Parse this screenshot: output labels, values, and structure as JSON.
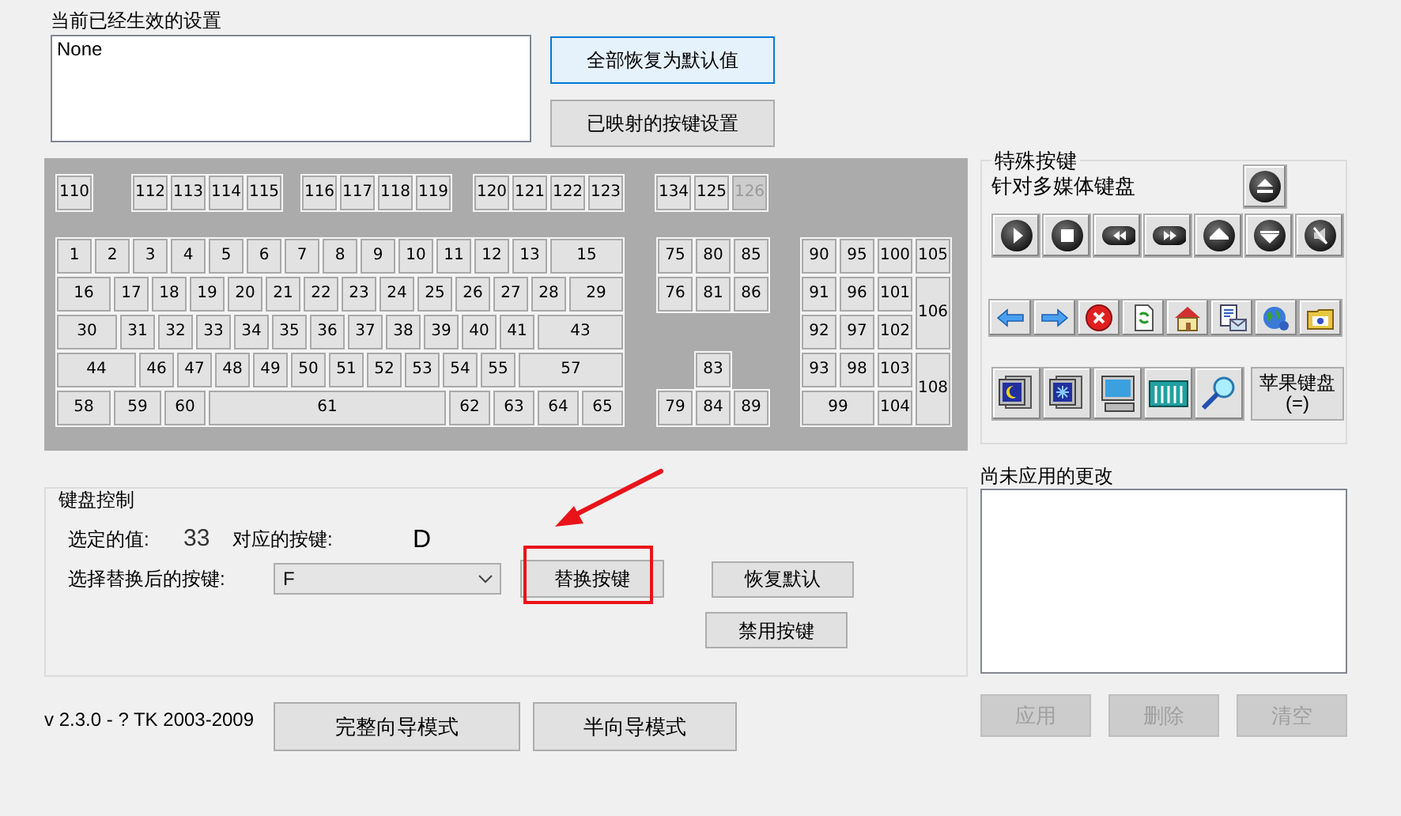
{
  "current_settings": {
    "label": "当前已经生效的设置",
    "items": [
      "None"
    ]
  },
  "top_buttons": [
    {
      "label": "全部恢复为默认值",
      "focused": true
    },
    {
      "label": "已映射的按键设置",
      "focused": false
    }
  ],
  "keyboard": {
    "function_row": [
      [
        {
          "label": "110",
          "disabled": false
        }
      ],
      [
        {
          "label": "112",
          "disabled": false
        },
        {
          "label": "113",
          "disabled": false
        },
        {
          "label": "114",
          "disabled": false
        },
        {
          "label": "115",
          "disabled": false
        }
      ],
      [
        {
          "label": "116",
          "disabled": false
        },
        {
          "label": "117",
          "disabled": false
        },
        {
          "label": "118",
          "disabled": false
        },
        {
          "label": "119",
          "disabled": false
        }
      ],
      [
        {
          "label": "120",
          "disabled": false
        },
        {
          "label": "121",
          "disabled": false
        },
        {
          "label": "122",
          "disabled": false
        },
        {
          "label": "123",
          "disabled": false
        }
      ],
      [
        {
          "label": "134",
          "disabled": false
        },
        {
          "label": "125",
          "disabled": false
        },
        {
          "label": "126",
          "disabled": true
        }
      ]
    ],
    "main_rows": [
      [
        "1",
        "2",
        "3",
        "4",
        "5",
        "6",
        "7",
        "8",
        "9",
        "10",
        "11",
        "12",
        "13",
        "15"
      ],
      [
        "16",
        "17",
        "18",
        "19",
        "20",
        "21",
        "22",
        "23",
        "24",
        "25",
        "26",
        "27",
        "28",
        "29"
      ],
      [
        "30",
        "31",
        "32",
        "33",
        "34",
        "35",
        "36",
        "37",
        "38",
        "39",
        "40",
        "41",
        "43"
      ],
      [
        "44",
        "46",
        "47",
        "48",
        "49",
        "50",
        "51",
        "52",
        "53",
        "54",
        "55",
        "57"
      ],
      [
        "58",
        "59",
        "60",
        "61",
        "62",
        "63",
        "64",
        "65"
      ]
    ],
    "nav_keys": [
      "75",
      "80",
      "85",
      "76",
      "81",
      "86",
      "83",
      "79",
      "84",
      "89"
    ],
    "numpad_keys": [
      "90",
      "95",
      "100",
      "105",
      "91",
      "96",
      "101",
      "106",
      "92",
      "97",
      "102",
      "93",
      "98",
      "103",
      "108",
      "99",
      "104"
    ]
  },
  "special_keys": {
    "title": "特殊按键",
    "subtitle": "针对多媒体键盘",
    "apple_button": {
      "label": "苹果键盘",
      "sub": "(=)"
    }
  },
  "keyboard_control": {
    "title": "键盘控制",
    "selected_value_label": "选定的值:",
    "selected_value": "33",
    "mapped_key_label": "对应的按键:",
    "mapped_key": "D",
    "replacement_label": "选择替换后的按键:",
    "replacement_key": "F",
    "buttons": [
      {
        "label": "替换按键",
        "highlighted": true
      },
      {
        "label": "恢复默认",
        "highlighted": false
      },
      {
        "label": "禁用按键",
        "highlighted": false
      }
    ]
  },
  "pending": {
    "label": "尚未应用的更改",
    "buttons": [
      {
        "label": "应用",
        "disabled": true
      },
      {
        "label": "删除",
        "disabled": true
      },
      {
        "label": "清空",
        "disabled": true
      }
    ]
  },
  "version": "v 2.3.0 - ? TK 2003-2009",
  "mode_buttons": [
    "完整向导模式",
    "半向导模式"
  ]
}
